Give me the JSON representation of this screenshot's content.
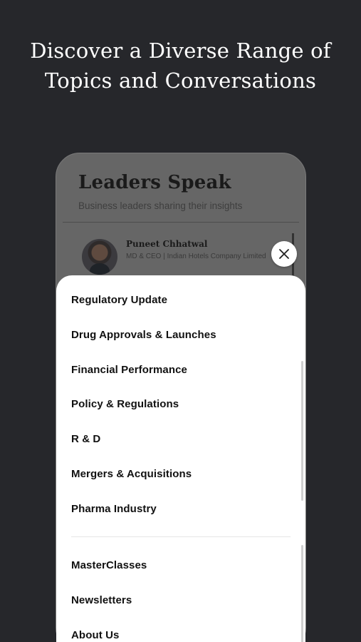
{
  "headline": {
    "line1": "Discover a Diverse Range of",
    "line2": "Topics and Conversations"
  },
  "phone": {
    "section_title": "Leaders Speak",
    "section_subtitle": "Business leaders sharing their insights",
    "leader": {
      "name": "Puneet Chhatwal",
      "role": "MD & CEO | Indian Hotels Company Limited"
    }
  },
  "close_icon": "close-icon",
  "menu": {
    "topics": [
      "Regulatory Update",
      "Drug Approvals & Launches",
      "Financial Performance",
      "Policy & Regulations",
      "R & D",
      "Mergers & Acquisitions",
      "Pharma Industry"
    ],
    "links": [
      "MasterClasses",
      "Newsletters",
      "About Us"
    ]
  },
  "colors": {
    "background": "#26272b",
    "sheet": "#ffffff",
    "overlay": "#666666",
    "text": "#111111"
  }
}
